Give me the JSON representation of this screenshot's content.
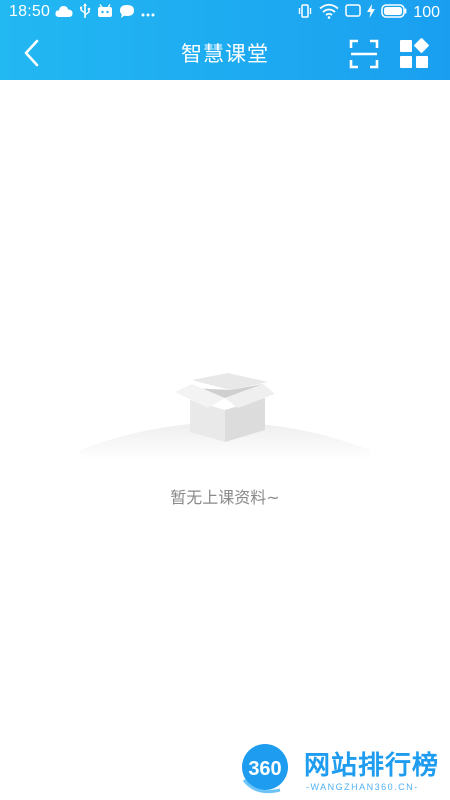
{
  "status_bar": {
    "time": "18:50",
    "battery": "100",
    "icons_left": [
      "cloud-icon",
      "usb-icon",
      "android-icon",
      "chat-icon",
      "more-dots-icon"
    ],
    "icons_right": [
      "vibrate-icon",
      "wifi-icon",
      "screen-icon",
      "charging-icon",
      "battery-icon"
    ]
  },
  "navbar": {
    "title": "智慧课堂",
    "back_icon": "chevron-left-icon",
    "scan_icon": "scan-icon",
    "apps_icon": "apps-grid-icon"
  },
  "empty_state": {
    "message": "暂无上课资料~",
    "illustration": "empty-box-icon"
  },
  "watermark": {
    "logo_text": "360",
    "brand": "网站排行榜",
    "sub": "-WANGZHAN360.CN-"
  },
  "colors": {
    "header_start": "#22b8f2",
    "header_end": "#1a9ff0",
    "empty_text": "#8a8a8a",
    "watermark": "#1e9cf0"
  }
}
